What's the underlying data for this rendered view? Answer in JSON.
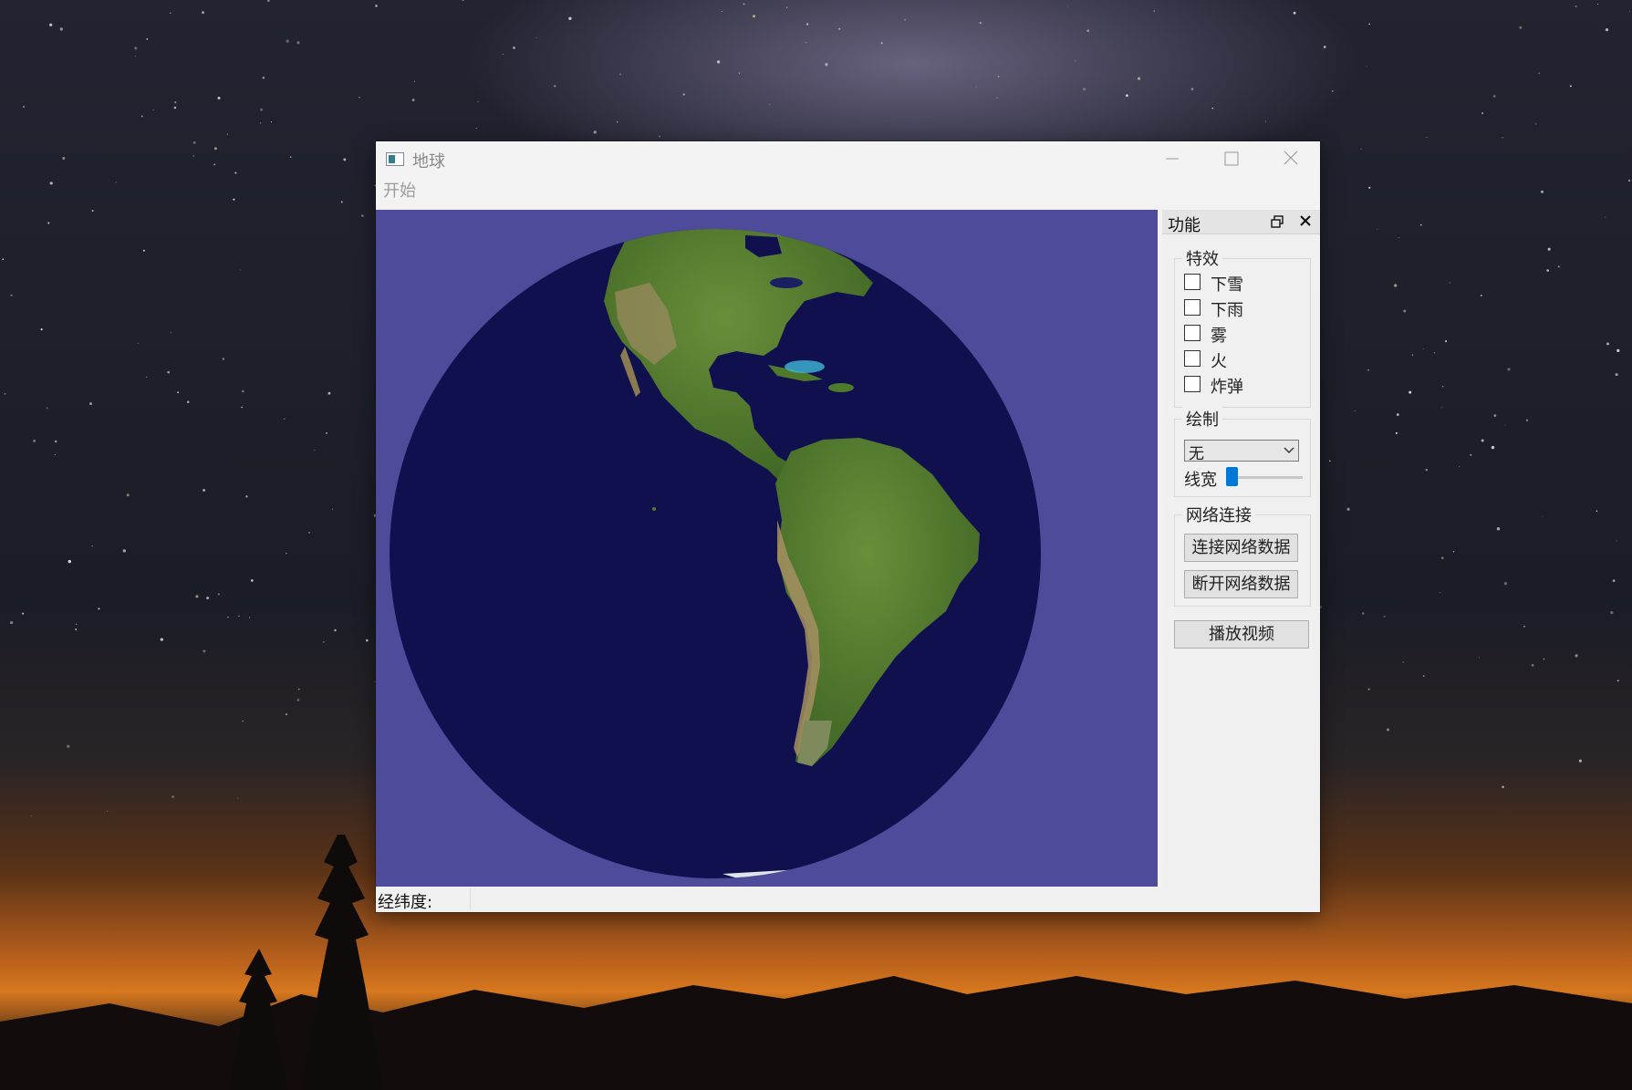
{
  "window": {
    "title": "地球",
    "controls": [
      "minimize-icon",
      "maximize-icon",
      "close-icon"
    ]
  },
  "menu": {
    "items": [
      "开始"
    ]
  },
  "dock": {
    "title": "功能",
    "effects": {
      "title": "特效",
      "items": [
        {
          "label": "下雪",
          "checked": false
        },
        {
          "label": "下雨",
          "checked": false
        },
        {
          "label": "雾",
          "checked": false
        },
        {
          "label": "火",
          "checked": false
        },
        {
          "label": "炸弹",
          "checked": false
        }
      ]
    },
    "draw": {
      "title": "绘制",
      "selected": "无",
      "width_label": "线宽",
      "width_level": 0
    },
    "network": {
      "title": "网络连接",
      "connect_label": "连接网络数据",
      "disconnect_label": "断开网络数据"
    },
    "play_video_label": "播放视频"
  },
  "statusbar": {
    "label": "经纬度:"
  },
  "colors": {
    "viewport_bg": "#4f4b9b",
    "ocean": "#11104f",
    "land": "#4f7a2c",
    "accent": "#0078d7"
  }
}
